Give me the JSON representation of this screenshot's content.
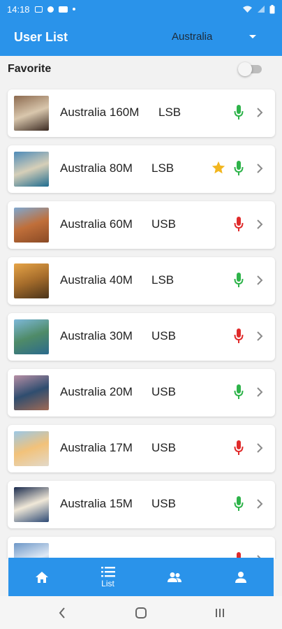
{
  "status_bar": {
    "time": "14:18"
  },
  "app_bar": {
    "title": "User List",
    "country": "Australia"
  },
  "favorite": {
    "label": "Favorite",
    "enabled": false
  },
  "users": [
    {
      "name": "Australia 160M",
      "mode": "LSB",
      "favorite": false,
      "mic": "green",
      "thumb": [
        "#8c6a4f",
        "#d9c7ad",
        "#3b2a22"
      ]
    },
    {
      "name": "Australia 80M",
      "mode": "LSB",
      "favorite": true,
      "mic": "green",
      "thumb": [
        "#4d8bb8",
        "#d6cfb8",
        "#1f6c8f"
      ]
    },
    {
      "name": "Australia 60M",
      "mode": "USB",
      "favorite": false,
      "mic": "red",
      "thumb": [
        "#7fa7cf",
        "#c06f3a",
        "#8a4a25"
      ]
    },
    {
      "name": "Australia 40M",
      "mode": "LSB",
      "favorite": false,
      "mic": "green",
      "thumb": [
        "#e6a447",
        "#a56c2b",
        "#4a3319"
      ]
    },
    {
      "name": "Australia 30M",
      "mode": "USB",
      "favorite": false,
      "mic": "red",
      "thumb": [
        "#7db8d9",
        "#4f8b68",
        "#2b6a8c"
      ]
    },
    {
      "name": "Australia 20M",
      "mode": "USB",
      "favorite": false,
      "mic": "green",
      "thumb": [
        "#b78fa5",
        "#2f4d6f",
        "#a06a55"
      ]
    },
    {
      "name": "Australia 17M",
      "mode": "USB",
      "favorite": false,
      "mic": "red",
      "thumb": [
        "#9cc8e6",
        "#f2c27a",
        "#e3d9c9"
      ]
    },
    {
      "name": "Australia 15M",
      "mode": "USB",
      "favorite": false,
      "mic": "green",
      "thumb": [
        "#1a2b4d",
        "#f0e8d8",
        "#2e4a75"
      ]
    },
    {
      "name": "",
      "mode": "",
      "favorite": false,
      "mic": "red",
      "thumb": [
        "#6d97c7",
        "#dfe9f5",
        "#3d6fa8"
      ]
    }
  ],
  "bottom_nav": [
    {
      "icon": "home-icon",
      "label": ""
    },
    {
      "icon": "list-icon",
      "label": "List"
    },
    {
      "icon": "group-icon",
      "label": ""
    },
    {
      "icon": "person-icon",
      "label": ""
    }
  ],
  "colors": {
    "primary": "#2a93ea",
    "mic_green": "#2eb34a",
    "mic_red": "#e02b2b",
    "star": "#f2b61f",
    "chevron": "#8a8a8a"
  }
}
